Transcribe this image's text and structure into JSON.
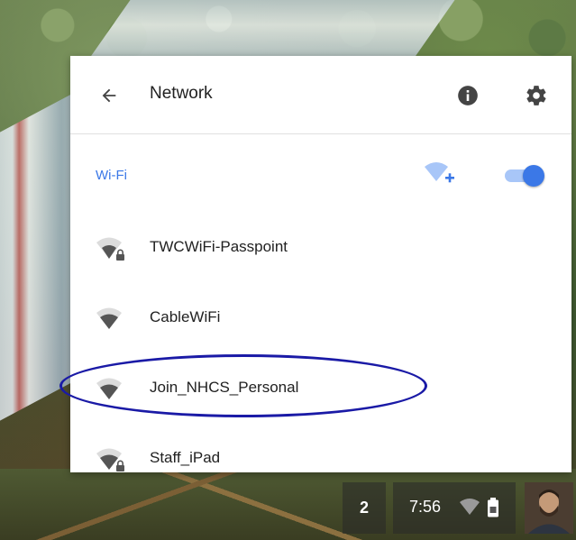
{
  "header": {
    "title": "Network",
    "back_icon": "arrow-back-icon",
    "info_icon": "info-icon",
    "settings_icon": "gear-icon"
  },
  "wifi": {
    "label": "Wi-Fi",
    "add_network_icon": "wifi-add-icon",
    "enabled": true,
    "accent_color": "#3b78e7"
  },
  "networks": [
    {
      "name": "TWCWiFi-Passpoint",
      "secured": true
    },
    {
      "name": "CableWiFi",
      "secured": false
    },
    {
      "name": "Join_NHCS_Personal",
      "secured": false,
      "highlighted": true
    },
    {
      "name": "Staff_iPad",
      "secured": true
    }
  ],
  "tray": {
    "notification_count": "2",
    "time": "7:56"
  },
  "colors": {
    "highlight_circle": "#1a1aa6"
  }
}
